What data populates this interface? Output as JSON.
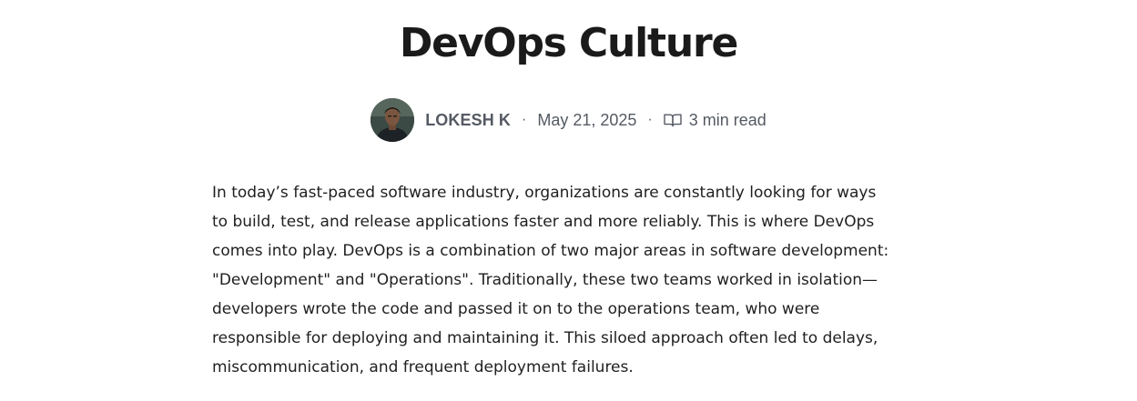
{
  "post": {
    "title": "DevOps Culture",
    "author": "LOKESH K",
    "date": "May 21, 2025",
    "read_time": "3 min read",
    "separator": "·",
    "avatar_icon": "author-photo",
    "read_icon": "open-book-icon"
  },
  "article": {
    "paragraph": "In today’s fast-paced software industry, organizations are constantly looking for ways to build, test, and release applications faster and more reliably. This is where DevOps comes into play. DevOps is a combination of two major areas in software development: \"Development\" and \"Operations\". Traditionally, these two teams worked in isolation—developers wrote the code and passed it on to the operations team, who were responsible for deploying and maintaining it. This siloed approach often led to delays, miscommunication, and frequent deployment failures."
  },
  "colors": {
    "title": "#1a1a1a",
    "meta": "#555a63",
    "body": "#1f1f1f",
    "background": "#ffffff"
  }
}
